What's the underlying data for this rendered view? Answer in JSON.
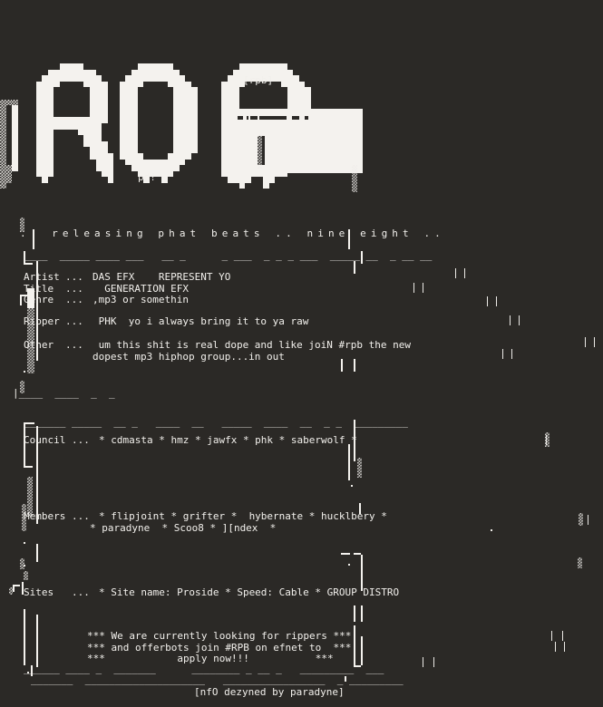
{
  "document": {
    "kind": "nfo-ascii-art",
    "group_tag": "[rpb]",
    "artist_signature": "pd!",
    "tagline": ".. releasing phat beats .. nine eight ..",
    "footer_credit": "[nfO dezyned by paradyne]"
  },
  "colors": {
    "background": "#2b2926",
    "foreground": "#f2f0ec"
  },
  "logo": {
    "text": "RPB",
    "style": "block-ascii"
  },
  "release_info": [
    {
      "label": "Artist",
      "dots": "...",
      "value": "DAS EFX    REPRESENT YO"
    },
    {
      "label": "Title",
      "dots": "...",
      "value": "  GENERATION EFX"
    },
    {
      "label": "Genre",
      "dots": "...",
      "value": ",mp3 or somethin"
    },
    {
      "label": "Ripper",
      "dots": "...",
      "value": " PHK  yo i always bring it to ya raw"
    }
  ],
  "other": {
    "label": "Other",
    "dots": "...",
    "line1": " um this shit is real dope and like joiN #rpb the new",
    "line2": "dopest mp3 hiphop group...in out"
  },
  "council": {
    "label": "Council",
    "dots": "...",
    "value": "* cdmasta * hmz * jawfx * phk * saberwolf *"
  },
  "members": {
    "label": "Members",
    "dots": "...",
    "line1": "* flipjoint * grifter *  hybernate * hucklbery *",
    "line2": "* paradyne  * Scoo8 * ][ndex  *"
  },
  "sites": {
    "label": "Sites",
    "dots": "...",
    "value": "* Site name: Proside * Speed: Cable * GROUP DISTRO"
  },
  "announcement": {
    "marker": "***",
    "line1": "We are currently looking for rippers",
    "line2": "and offerbots join #RPB on efnet to",
    "line3": "apply now!!!"
  },
  "rules": {
    "r1": "____  _____ ____ ___   __ _      _ ___  _ _ _ ___  _____ __  _ __ __",
    "r2": "|____  ____  _  _",
    "r3": "_______ _____  __ _   ____  __   _____  ____  __  _ _  _________",
    "r4": "______ ____ _  _______      ________ _ __ _   _________  ___",
    "r5": "_______  ____________________   _________________  _ _________"
  }
}
